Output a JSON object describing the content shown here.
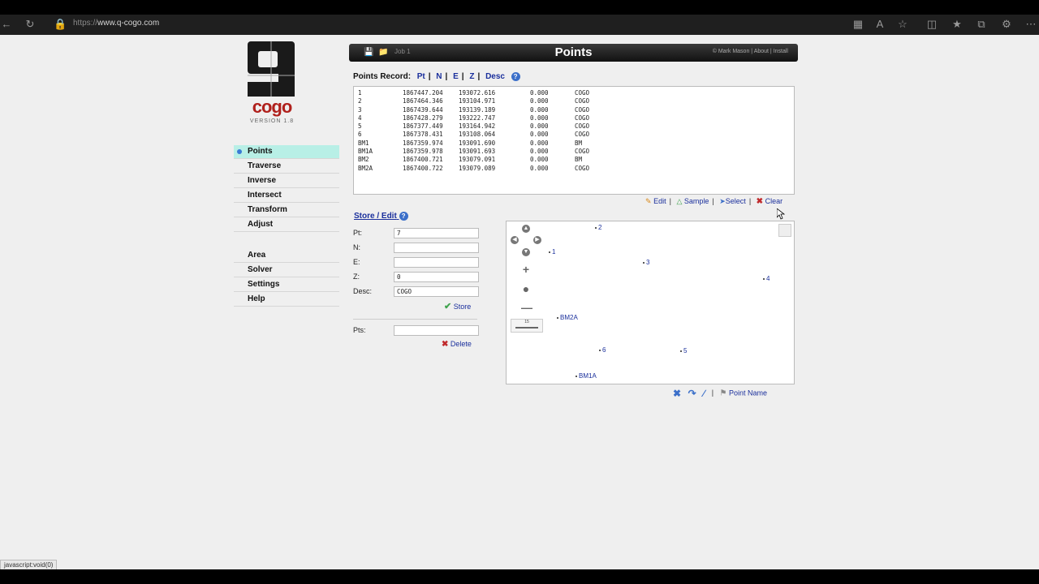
{
  "browser": {
    "url_prefix": "https://",
    "url_host": "www.q-cogo.com",
    "status_text": "javascript:void(0)"
  },
  "logo": {
    "text": "cogo",
    "version": "VERSION 1.8"
  },
  "nav": {
    "group1": [
      "Points",
      "Traverse",
      "Inverse",
      "Intersect",
      "Transform",
      "Adjust"
    ],
    "group2": [
      "Area",
      "Solver",
      "Settings",
      "Help"
    ],
    "active": "Points"
  },
  "header": {
    "title": "Points",
    "job": "Job 1",
    "author": "© Mark Mason",
    "about": "About",
    "install": "Install"
  },
  "records": {
    "label": "Points Record:",
    "sort_links": [
      "Pt",
      "N",
      "E",
      "Z",
      "Desc"
    ],
    "rows": [
      [
        "1",
        "1867447.204",
        "193072.616",
        "0.000",
        "COGO"
      ],
      [
        "2",
        "1867464.346",
        "193104.971",
        "0.000",
        "COGO"
      ],
      [
        "3",
        "1867439.644",
        "193139.189",
        "0.000",
        "COGO"
      ],
      [
        "4",
        "1867428.279",
        "193222.747",
        "0.000",
        "COGO"
      ],
      [
        "5",
        "1867377.449",
        "193164.942",
        "0.000",
        "COGO"
      ],
      [
        "6",
        "1867378.431",
        "193108.064",
        "0.000",
        "COGO"
      ],
      [
        "BM1",
        "1867359.974",
        "193091.690",
        "0.000",
        "BM"
      ],
      [
        "BM1A",
        "1867359.978",
        "193091.693",
        "0.000",
        "COGO"
      ],
      [
        "BM2",
        "1867400.721",
        "193079.091",
        "0.000",
        "BM"
      ],
      [
        "BM2A",
        "1867400.722",
        "193079.089",
        "0.000",
        "COGO"
      ]
    ],
    "actions": {
      "edit": "Edit",
      "sample": "Sample",
      "select": "Select",
      "clear": "Clear"
    }
  },
  "store_edit": {
    "title": "Store / Edit",
    "pt_label": "Pt:",
    "pt_value": "7",
    "n_label": "N:",
    "n_value": "",
    "e_label": "E:",
    "e_value": "",
    "z_label": "Z:",
    "z_value": "0",
    "desc_label": "Desc:",
    "desc_value": "COGO",
    "store_button": "Store",
    "pts_label": "Pts:",
    "pts_value": "",
    "delete_button": "Delete"
  },
  "map": {
    "scale_label": "15",
    "points": [
      {
        "name": "2"
      },
      {
        "name": "1"
      },
      {
        "name": "3"
      },
      {
        "name": "4"
      },
      {
        "name": "BM2A"
      },
      {
        "name": "6"
      },
      {
        "name": "5"
      },
      {
        "name": "BM1A"
      }
    ],
    "tools_label": "Point Name"
  }
}
